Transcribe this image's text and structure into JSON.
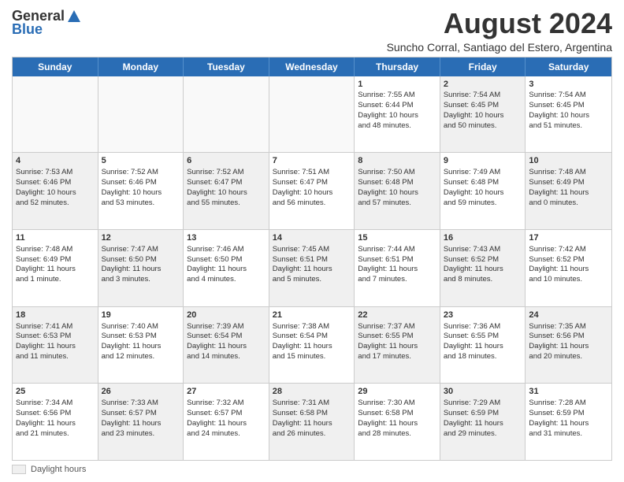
{
  "logo": {
    "general": "General",
    "blue": "Blue"
  },
  "title": "August 2024",
  "subtitle": "Suncho Corral, Santiago del Estero, Argentina",
  "legend": {
    "box_label": "Daylight hours"
  },
  "header": {
    "days": [
      "Sunday",
      "Monday",
      "Tuesday",
      "Wednesday",
      "Thursday",
      "Friday",
      "Saturday"
    ]
  },
  "rows": [
    {
      "cells": [
        {
          "day": "",
          "content": "",
          "empty": true
        },
        {
          "day": "",
          "content": "",
          "empty": true
        },
        {
          "day": "",
          "content": "",
          "empty": true
        },
        {
          "day": "",
          "content": "",
          "empty": true
        },
        {
          "day": "1",
          "content": "Sunrise: 7:55 AM\nSunset: 6:44 PM\nDaylight: 10 hours\nand 48 minutes.",
          "shaded": false
        },
        {
          "day": "2",
          "content": "Sunrise: 7:54 AM\nSunset: 6:45 PM\nDaylight: 10 hours\nand 50 minutes.",
          "shaded": true
        },
        {
          "day": "3",
          "content": "Sunrise: 7:54 AM\nSunset: 6:45 PM\nDaylight: 10 hours\nand 51 minutes.",
          "shaded": false
        }
      ]
    },
    {
      "cells": [
        {
          "day": "4",
          "content": "Sunrise: 7:53 AM\nSunset: 6:46 PM\nDaylight: 10 hours\nand 52 minutes.",
          "shaded": true
        },
        {
          "day": "5",
          "content": "Sunrise: 7:52 AM\nSunset: 6:46 PM\nDaylight: 10 hours\nand 53 minutes.",
          "shaded": false
        },
        {
          "day": "6",
          "content": "Sunrise: 7:52 AM\nSunset: 6:47 PM\nDaylight: 10 hours\nand 55 minutes.",
          "shaded": true
        },
        {
          "day": "7",
          "content": "Sunrise: 7:51 AM\nSunset: 6:47 PM\nDaylight: 10 hours\nand 56 minutes.",
          "shaded": false
        },
        {
          "day": "8",
          "content": "Sunrise: 7:50 AM\nSunset: 6:48 PM\nDaylight: 10 hours\nand 57 minutes.",
          "shaded": true
        },
        {
          "day": "9",
          "content": "Sunrise: 7:49 AM\nSunset: 6:48 PM\nDaylight: 10 hours\nand 59 minutes.",
          "shaded": false
        },
        {
          "day": "10",
          "content": "Sunrise: 7:48 AM\nSunset: 6:49 PM\nDaylight: 11 hours\nand 0 minutes.",
          "shaded": true
        }
      ]
    },
    {
      "cells": [
        {
          "day": "11",
          "content": "Sunrise: 7:48 AM\nSunset: 6:49 PM\nDaylight: 11 hours\nand 1 minute.",
          "shaded": false
        },
        {
          "day": "12",
          "content": "Sunrise: 7:47 AM\nSunset: 6:50 PM\nDaylight: 11 hours\nand 3 minutes.",
          "shaded": true
        },
        {
          "day": "13",
          "content": "Sunrise: 7:46 AM\nSunset: 6:50 PM\nDaylight: 11 hours\nand 4 minutes.",
          "shaded": false
        },
        {
          "day": "14",
          "content": "Sunrise: 7:45 AM\nSunset: 6:51 PM\nDaylight: 11 hours\nand 5 minutes.",
          "shaded": true
        },
        {
          "day": "15",
          "content": "Sunrise: 7:44 AM\nSunset: 6:51 PM\nDaylight: 11 hours\nand 7 minutes.",
          "shaded": false
        },
        {
          "day": "16",
          "content": "Sunrise: 7:43 AM\nSunset: 6:52 PM\nDaylight: 11 hours\nand 8 minutes.",
          "shaded": true
        },
        {
          "day": "17",
          "content": "Sunrise: 7:42 AM\nSunset: 6:52 PM\nDaylight: 11 hours\nand 10 minutes.",
          "shaded": false
        }
      ]
    },
    {
      "cells": [
        {
          "day": "18",
          "content": "Sunrise: 7:41 AM\nSunset: 6:53 PM\nDaylight: 11 hours\nand 11 minutes.",
          "shaded": true
        },
        {
          "day": "19",
          "content": "Sunrise: 7:40 AM\nSunset: 6:53 PM\nDaylight: 11 hours\nand 12 minutes.",
          "shaded": false
        },
        {
          "day": "20",
          "content": "Sunrise: 7:39 AM\nSunset: 6:54 PM\nDaylight: 11 hours\nand 14 minutes.",
          "shaded": true
        },
        {
          "day": "21",
          "content": "Sunrise: 7:38 AM\nSunset: 6:54 PM\nDaylight: 11 hours\nand 15 minutes.",
          "shaded": false
        },
        {
          "day": "22",
          "content": "Sunrise: 7:37 AM\nSunset: 6:55 PM\nDaylight: 11 hours\nand 17 minutes.",
          "shaded": true
        },
        {
          "day": "23",
          "content": "Sunrise: 7:36 AM\nSunset: 6:55 PM\nDaylight: 11 hours\nand 18 minutes.",
          "shaded": false
        },
        {
          "day": "24",
          "content": "Sunrise: 7:35 AM\nSunset: 6:56 PM\nDaylight: 11 hours\nand 20 minutes.",
          "shaded": true
        }
      ]
    },
    {
      "cells": [
        {
          "day": "25",
          "content": "Sunrise: 7:34 AM\nSunset: 6:56 PM\nDaylight: 11 hours\nand 21 minutes.",
          "shaded": false
        },
        {
          "day": "26",
          "content": "Sunrise: 7:33 AM\nSunset: 6:57 PM\nDaylight: 11 hours\nand 23 minutes.",
          "shaded": true
        },
        {
          "day": "27",
          "content": "Sunrise: 7:32 AM\nSunset: 6:57 PM\nDaylight: 11 hours\nand 24 minutes.",
          "shaded": false
        },
        {
          "day": "28",
          "content": "Sunrise: 7:31 AM\nSunset: 6:58 PM\nDaylight: 11 hours\nand 26 minutes.",
          "shaded": true
        },
        {
          "day": "29",
          "content": "Sunrise: 7:30 AM\nSunset: 6:58 PM\nDaylight: 11 hours\nand 28 minutes.",
          "shaded": false
        },
        {
          "day": "30",
          "content": "Sunrise: 7:29 AM\nSunset: 6:59 PM\nDaylight: 11 hours\nand 29 minutes.",
          "shaded": true
        },
        {
          "day": "31",
          "content": "Sunrise: 7:28 AM\nSunset: 6:59 PM\nDaylight: 11 hours\nand 31 minutes.",
          "shaded": false
        }
      ]
    }
  ]
}
